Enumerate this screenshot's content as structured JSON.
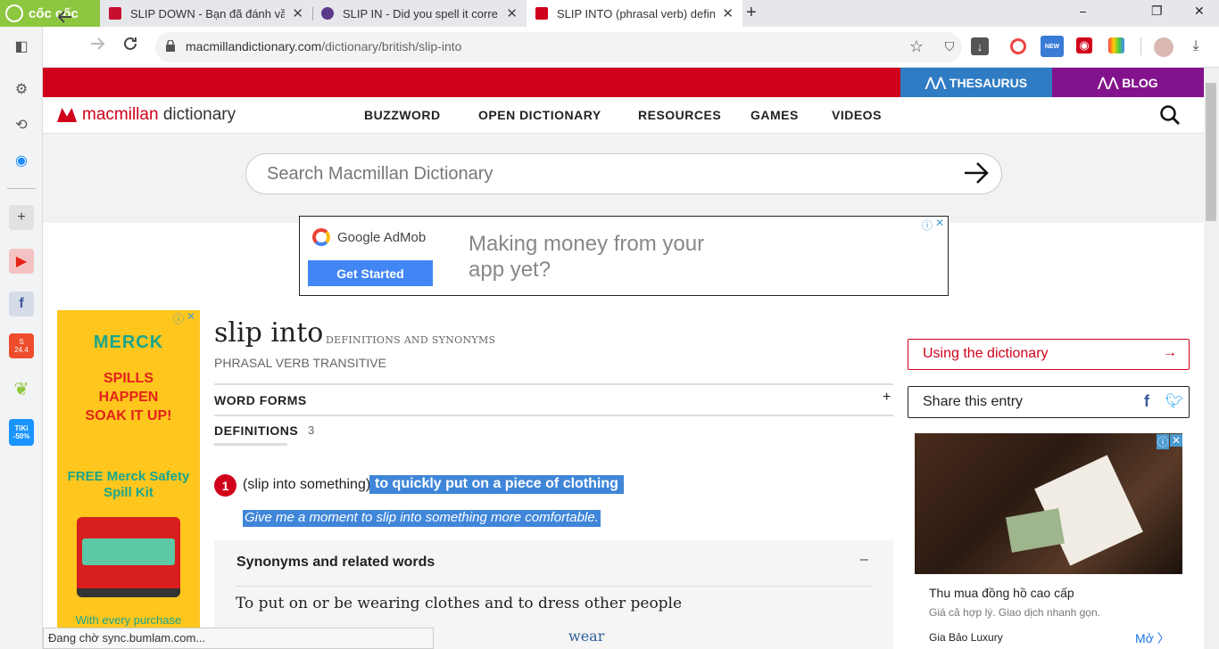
{
  "browser": {
    "brand": "cốc cốc",
    "tabs": [
      {
        "title": "SLIP DOWN - Bạn đã đánh vầ",
        "close": "✕"
      },
      {
        "title": "SLIP IN - Did you spell it corre",
        "close": "✕"
      },
      {
        "title": "SLIP INTO (phrasal verb) defin",
        "close": "✕"
      }
    ],
    "new_tab": "+",
    "window": {
      "minimize": "⎯",
      "restore": "❐",
      "close": "✕"
    },
    "url_host": "macmillandictionary.com",
    "url_path": "/dictionary/british/slip-into",
    "new_badge": "NEW",
    "sidebar_badges": {
      "shopee": "24.4",
      "tiki": "TiKi -50%"
    }
  },
  "site": {
    "thesaurus": "THESAURUS",
    "blog": "BLOG",
    "logo_left": "macmillan",
    "logo_right": "dictionary",
    "nav": [
      "BUZZWORD",
      "OPEN DICTIONARY",
      "RESOURCES",
      "GAMES",
      "VIDEOS"
    ],
    "search_placeholder": "Search Macmillan Dictionary"
  },
  "ad_top": {
    "brand": "Google AdMob",
    "button": "Get Started",
    "text": "Making money from your app yet?"
  },
  "ad_left": {
    "brand": "MERCK",
    "headline": "SPILLS HAPPEN SOAK IT UP!",
    "offer": "FREE Merck Safety Spill Kit",
    "footer": "With every purchase"
  },
  "entry": {
    "headword": "slip into",
    "subtitle": "DEFINITIONS AND SYNONYMS",
    "pos": "PHRASAL VERB  TRANSITIVE",
    "word_forms": "WORD FORMS",
    "definitions_label": "DEFINITIONS",
    "definitions_count": "3",
    "sense_number": "1",
    "sense_grammar": "(slip into something)",
    "sense_definition": "to quickly put on a piece of clothing",
    "example": "Give me a moment to slip into something more comfortable.",
    "synonyms_heading": "Synonyms and related words",
    "synonyms_toggle": "–",
    "synonyms_description": "To put on or be wearing clothes and to dress other people",
    "synonym_word": "wear"
  },
  "sidebar_right": {
    "using": "Using the dictionary",
    "share": "Share this entry",
    "ad_title": "Thu mua đồng hồ cao cấp",
    "ad_sub": "Giá cả hợp lý. Giao dịch nhanh gọn.",
    "ad_source": "Gia Bảo Luxury",
    "ad_more": "Mở"
  },
  "status": "Đang chờ sync.bumlam.com...",
  "colors": {
    "red": "#d0021b",
    "thesaurus_blue": "#2f7cc4",
    "blog_purple": "#83138c",
    "highlight": "#3f86d9"
  }
}
